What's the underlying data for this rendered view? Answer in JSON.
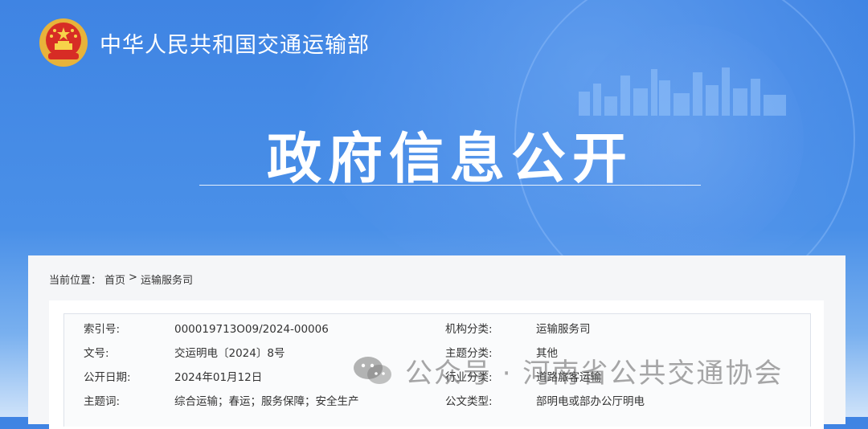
{
  "header": {
    "site_title": "中华人民共和国交通运输部",
    "emblem_icon": "national-emblem-icon"
  },
  "hero": {
    "title": "政府信息公开"
  },
  "breadcrumb": {
    "label": "当前位置：",
    "home": "首页",
    "separator": ">",
    "current": "运输服务司"
  },
  "info_table": {
    "rows": [
      {
        "label1": "索引号:",
        "value1": "000019713O09/2024-00006",
        "label2": "机构分类:",
        "value2": "运输服务司"
      },
      {
        "label1": "文号:",
        "value1": "交运明电〔2024〕8号",
        "label2": "主题分类:",
        "value2": "其他"
      },
      {
        "label1": "公开日期:",
        "value1": "2024年01月12日",
        "label2": "行业分类:",
        "value2": "道路旅客运输"
      },
      {
        "label1": "主题词:",
        "value1": "综合运输；春运；服务保障；安全生产",
        "label2": "公文类型:",
        "value2": "部明电或部办公厅明电"
      }
    ]
  },
  "watermark": {
    "text": "公众号 · 河南省公共交通协会",
    "icon": "wechat-icon"
  },
  "colors": {
    "banner_blue": "#4a90e8",
    "panel_bg": "#f5f6f8",
    "text": "#333333"
  }
}
